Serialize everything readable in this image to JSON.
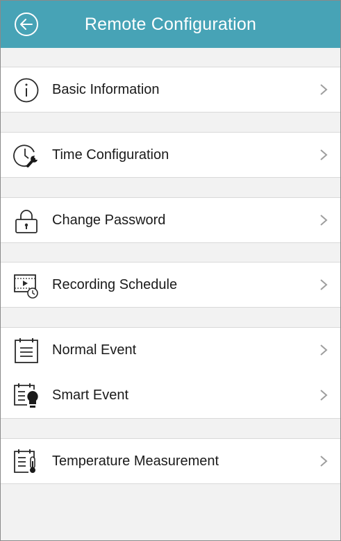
{
  "header": {
    "title": "Remote Configuration",
    "back_icon": "back-arrow-circle-icon",
    "color": "#47a3b6"
  },
  "menu": [
    {
      "label": "Basic Information",
      "icon": "info-icon"
    },
    {
      "label": "Time Configuration",
      "icon": "clock-wrench-icon"
    },
    {
      "label": "Change Password",
      "icon": "lock-icon"
    },
    {
      "label": "Recording Schedule",
      "icon": "video-schedule-icon"
    },
    {
      "label": "Normal Event",
      "icon": "clipboard-icon"
    },
    {
      "label": "Smart Event",
      "icon": "clipboard-bulb-icon"
    },
    {
      "label": "Temperature Measurement",
      "icon": "clipboard-thermometer-icon"
    }
  ],
  "chevron_icon": "chevron-right-icon"
}
